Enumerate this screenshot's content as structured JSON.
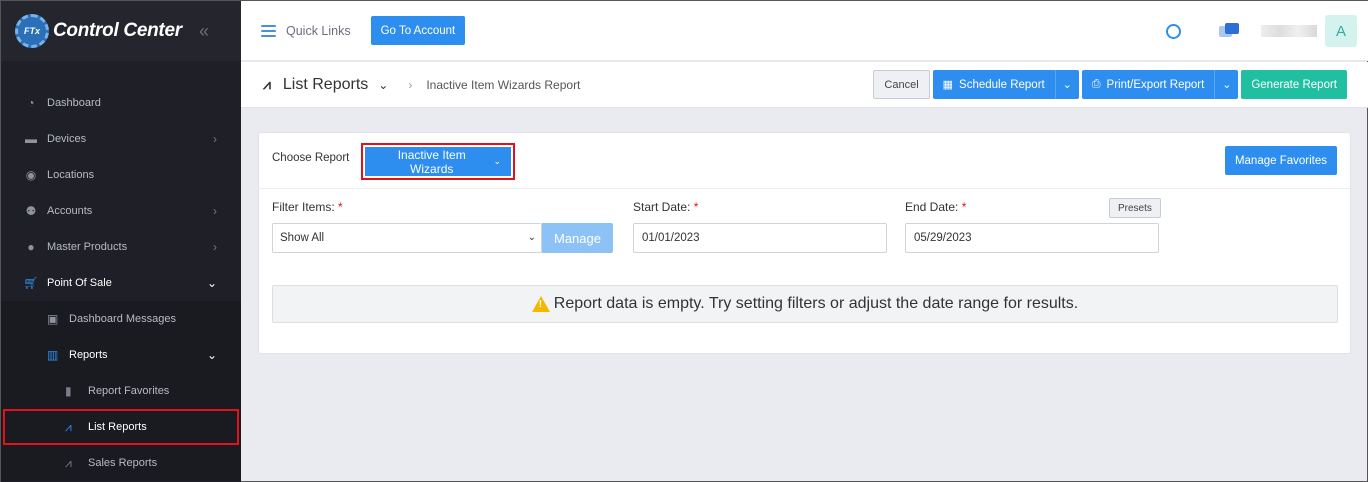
{
  "sidebar": {
    "brand_badge": "FTx",
    "brand_title": "Control Center",
    "collapse_glyph": "«",
    "items": [
      {
        "label": "Dashboard",
        "icon": "dashboard-icon"
      },
      {
        "label": "Devices",
        "icon": "devices-icon"
      },
      {
        "label": "Locations",
        "icon": "location-pin-icon"
      },
      {
        "label": "Accounts",
        "icon": "users-icon"
      },
      {
        "label": "Master Products",
        "icon": "products-icon"
      },
      {
        "label": "Point Of Sale",
        "icon": "cart-icon"
      }
    ],
    "pos_submenu": [
      {
        "label": "Dashboard Messages",
        "icon": "messages-icon"
      },
      {
        "label": "Reports",
        "icon": "bar-chart-icon"
      }
    ],
    "reports_submenu": [
      {
        "label": "Report Favorites",
        "icon": "bookmark-icon"
      },
      {
        "label": "List Reports",
        "icon": "line-chart-icon"
      },
      {
        "label": "Sales Reports",
        "icon": "line-chart-icon"
      }
    ]
  },
  "topbar": {
    "quick_links": "Quick Links",
    "go_to_account": "Go To Account",
    "avatar_initial": "A"
  },
  "subheader": {
    "title": "List Reports",
    "breadcrumb": "Inactive Item Wizards Report",
    "cancel": "Cancel",
    "schedule": "Schedule Report",
    "print_export": "Print/Export Report",
    "generate": "Generate Report"
  },
  "card": {
    "choose_label": "Choose Report",
    "selected_report": "Inactive Item Wizards",
    "manage_favorites": "Manage Favorites",
    "filter_label": "Filter Items:",
    "filter_value": "Show All",
    "manage": "Manage",
    "start_label": "Start Date:",
    "start_value": "01/01/2023",
    "end_label": "End Date:",
    "end_value": "05/29/2023",
    "presets": "Presets",
    "required_mark": "*",
    "empty_message": "Report data is empty. Try setting filters or adjust the date range for results."
  },
  "colors": {
    "primary": "#2d8ef0",
    "success": "#21bfa2",
    "highlight_border": "#e0121b",
    "sidebar_bg": "#1f2027"
  }
}
